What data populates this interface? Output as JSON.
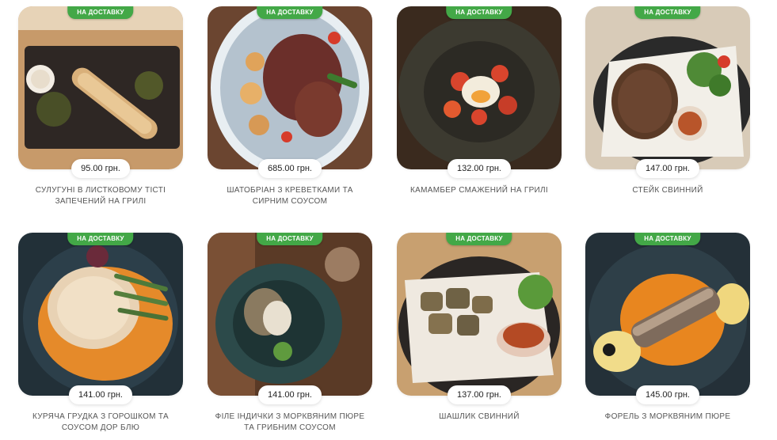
{
  "badge_label": "НА ДОСТАВКУ",
  "colors": {
    "badge": "#43a847",
    "text": "#555555"
  },
  "products": [
    {
      "name": "СУЛУГУНІ В ЛИСТКОВОМУ ТІСТІ ЗАПЕЧЕНИЙ НА ГРИЛІ",
      "price": "95.00 грн."
    },
    {
      "name": "ШАТОБРІАН З КРЕВЕТКАМИ ТА СИРНИМ СОУСОМ",
      "price": "685.00 грн."
    },
    {
      "name": "КАМАМБЕР СМАЖЕНИЙ НА ГРИЛІ",
      "price": "132.00 грн."
    },
    {
      "name": "СТЕЙК СВИННИЙ",
      "price": "147.00 грн."
    },
    {
      "name": "КУРЯЧА ГРУДКА З ГОРОШКОМ ТА СОУСОМ ДОР БЛЮ",
      "price": "141.00 грн."
    },
    {
      "name": "ФІЛЕ ІНДИЧКИ З МОРКВЯНИМ ПЮРЕ ТА ГРИБНИМ СОУСОМ",
      "price": "141.00 грн."
    },
    {
      "name": "ШАШЛИК СВИННИЙ",
      "price": "137.00 грн."
    },
    {
      "name": "ФОРЕЛЬ З МОРКВЯНИМ ПЮРЕ",
      "price": "145.00 грн."
    }
  ]
}
